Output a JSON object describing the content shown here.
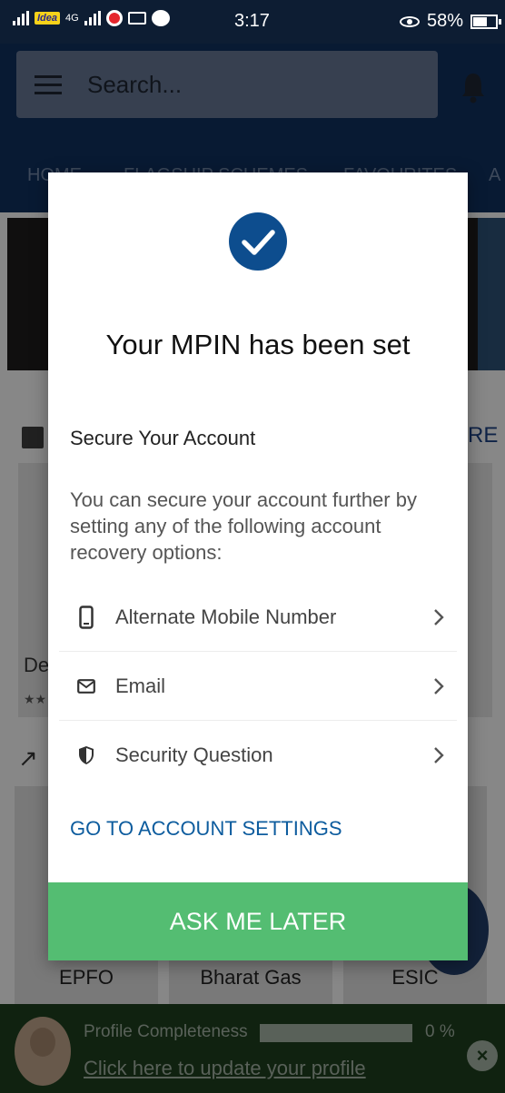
{
  "status_bar": {
    "carrier": "Idea",
    "network": "4G",
    "time": "3:17",
    "battery": "58%"
  },
  "app_bar": {
    "search_placeholder": "Search...",
    "menu_icon": "hamburger-icon",
    "notification_icon": "bell-icon",
    "tabs": [
      {
        "label": "HOME"
      },
      {
        "label": "FLAGSHIP SCHEMES"
      },
      {
        "label": "FAVOURITES"
      },
      {
        "label": "A"
      }
    ]
  },
  "background": {
    "more_label": "RE",
    "card_title": "De",
    "card_rating": "★★",
    "tiles": [
      {
        "label": "EPFO"
      },
      {
        "label": "Bharat Gas"
      },
      {
        "label": "ESIC"
      }
    ]
  },
  "profile_bar": {
    "label": "Profile Completeness",
    "progress": 0,
    "progress_text": "0 %",
    "link": "Click here to update your profile"
  },
  "dialog": {
    "title": "Your MPIN has been set",
    "section_heading": "Secure Your Account",
    "description": "You can secure your account further by setting any of the following account recovery options:",
    "options": [
      {
        "label": "Alternate Mobile Number",
        "icon": "mobile-phone-icon"
      },
      {
        "label": "Email",
        "icon": "envelope-icon"
      },
      {
        "label": "Security Question",
        "icon": "shield-icon"
      }
    ],
    "settings_link": "GO TO ACCOUNT SETTINGS",
    "later_button": "ASK ME LATER"
  },
  "colors": {
    "primary_dark": "#0e2d59",
    "check_circle": "#0d4d8e",
    "link_blue": "#0d5c9e",
    "button_green": "#54bd72"
  }
}
